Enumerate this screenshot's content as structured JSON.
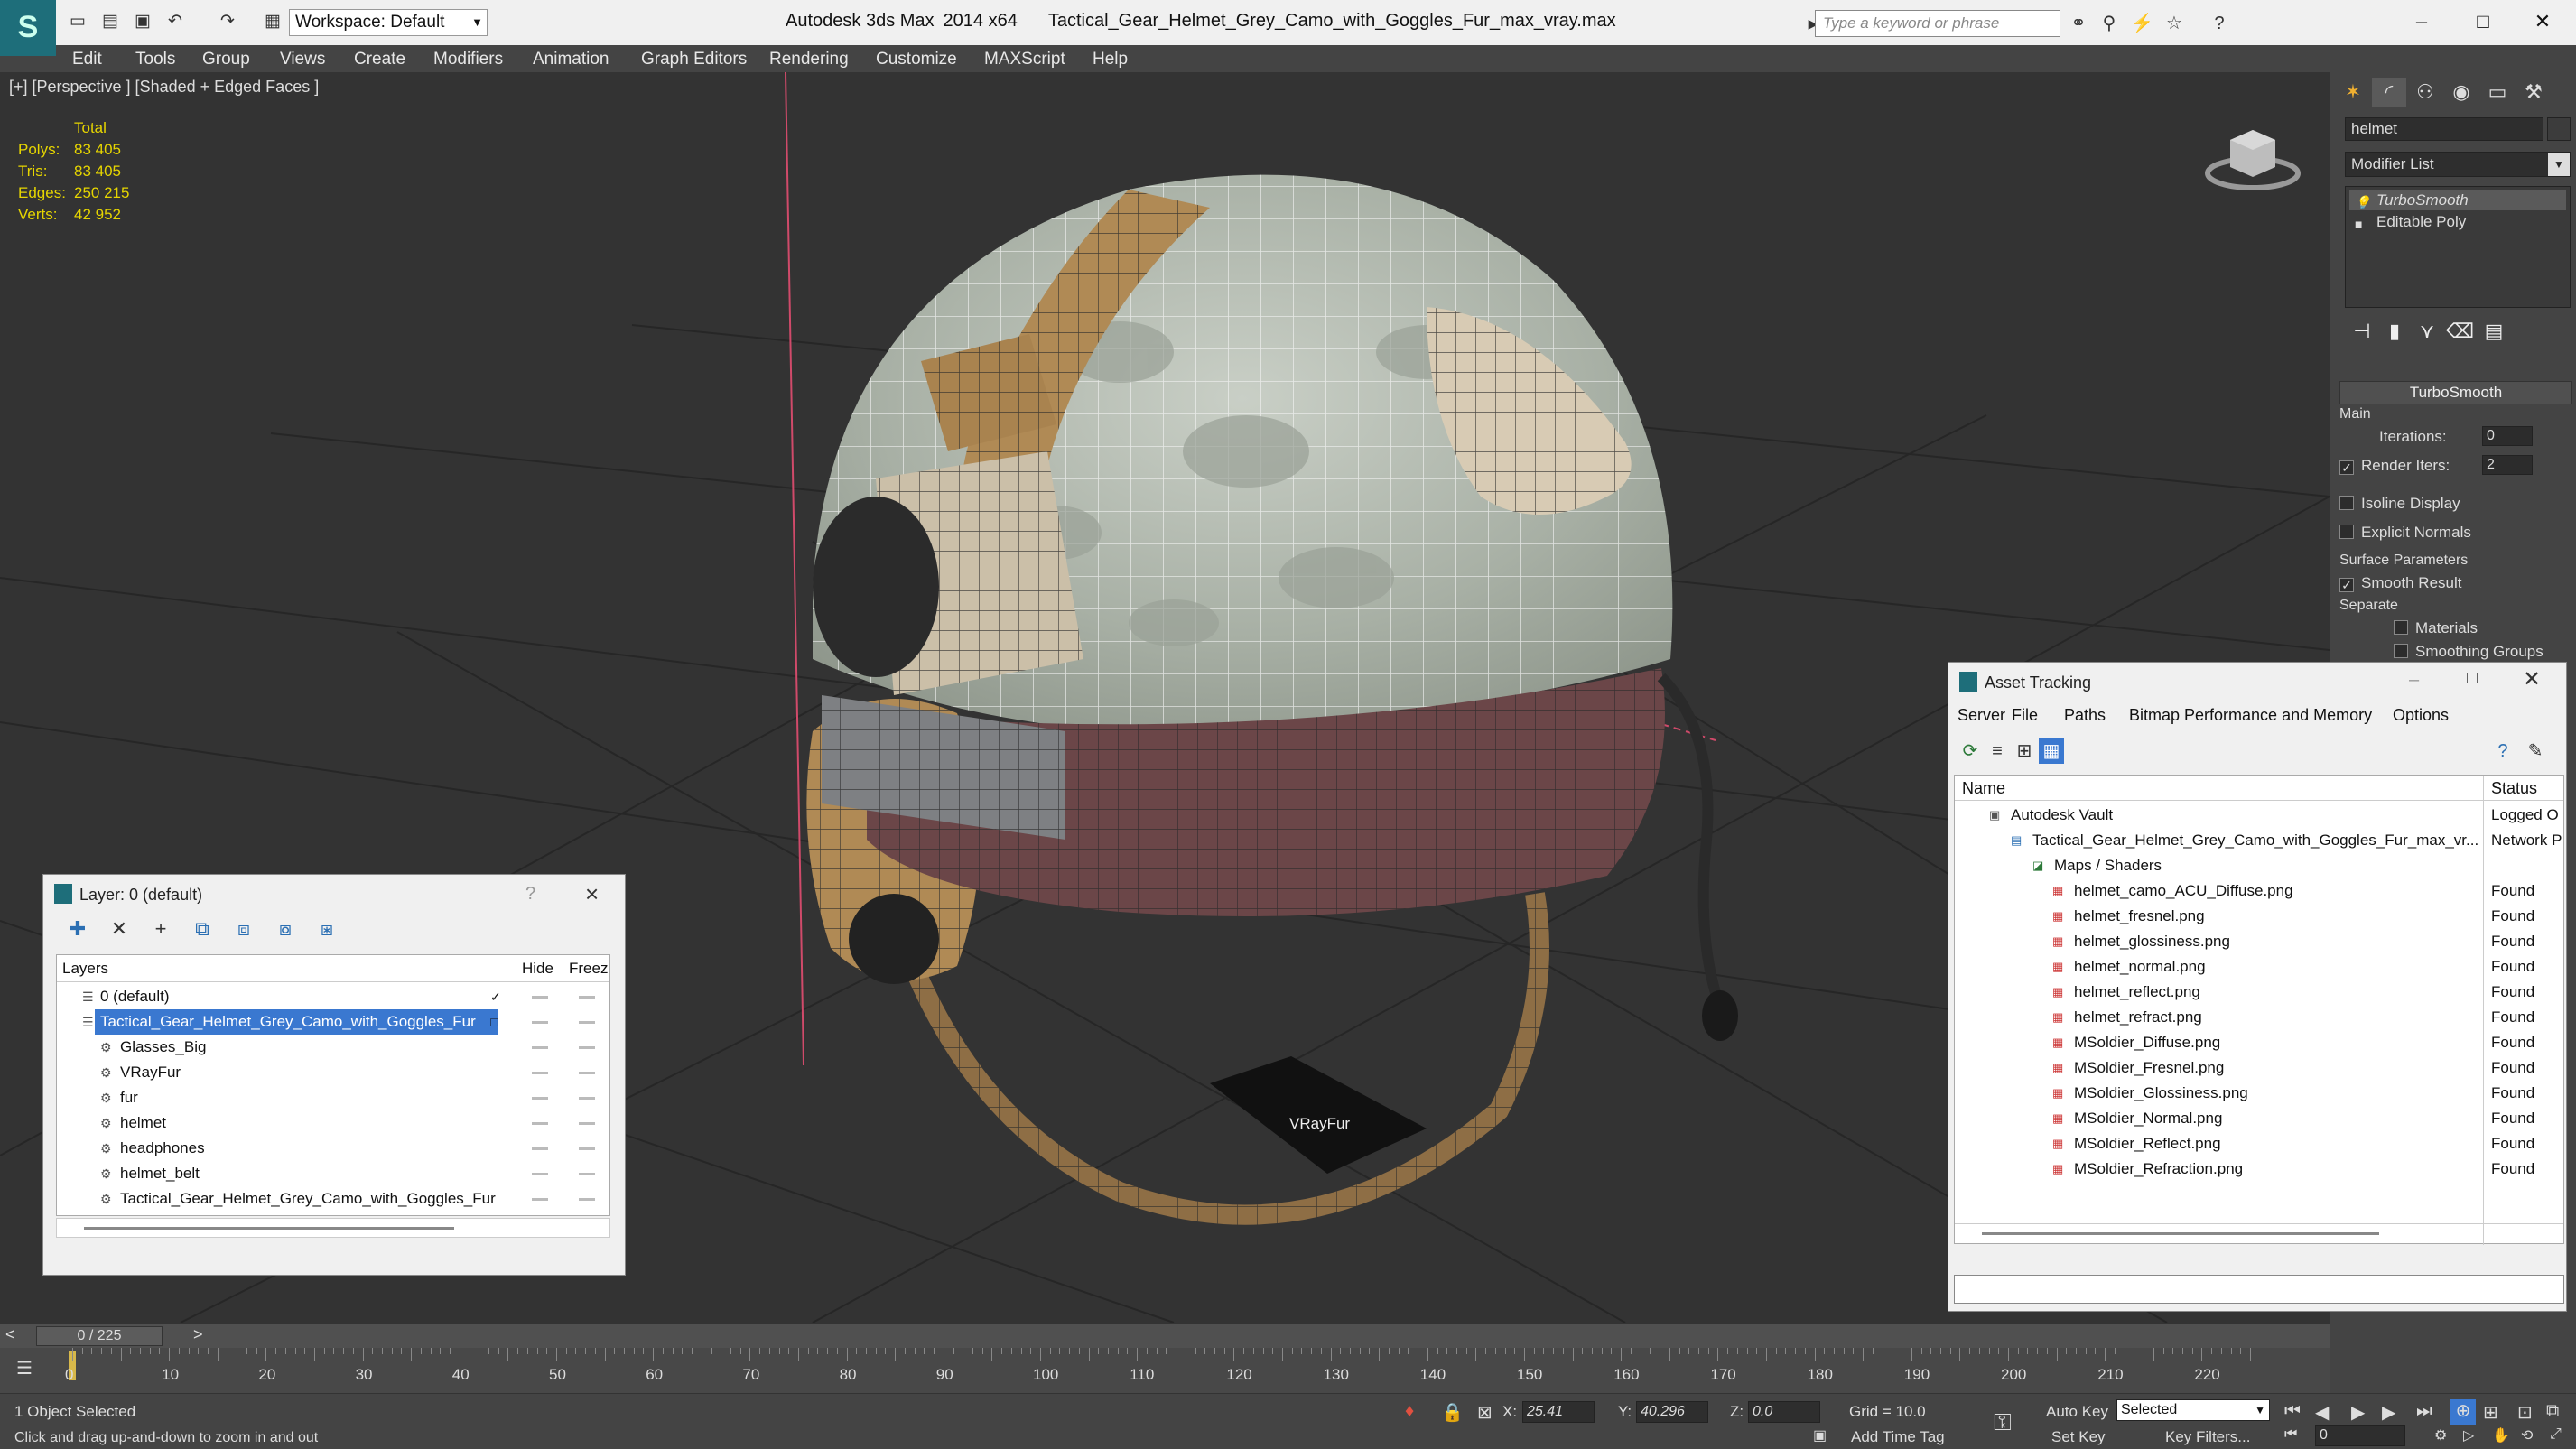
{
  "titlebar": {
    "app": "Autodesk 3ds Max",
    "version": "2014 x64",
    "file": "Tactical_Gear_Helmet_Grey_Camo_with_Goggles_Fur_max_vray.max",
    "workspace": "Workspace: Default",
    "search_placeholder": "Type a keyword or phrase"
  },
  "menu": [
    "Edit",
    "Tools",
    "Group",
    "Views",
    "Create",
    "Modifiers",
    "Animation",
    "Graph Editors",
    "Rendering",
    "Customize",
    "MAXScript",
    "Help"
  ],
  "viewport": {
    "label": "[+] [Perspective ] [Shaded + Edged Faces ]",
    "object_label": "VRayFur"
  },
  "stats": {
    "header": "Total",
    "rows": [
      {
        "label": "Polys:",
        "value": "83 405"
      },
      {
        "label": "Tris:",
        "value": "83 405"
      },
      {
        "label": "Edges:",
        "value": "250 215"
      },
      {
        "label": "Verts:",
        "value": "42 952"
      }
    ]
  },
  "command_panel": {
    "object_name": "helmet",
    "modifier_list": "Modifier List",
    "stack": [
      "TurboSmooth",
      "Editable Poly"
    ],
    "rollout": "TurboSmooth",
    "main": "Main",
    "iterations_label": "Iterations:",
    "iterations": "0",
    "render_iters_label": "Render Iters:",
    "render_iters": "2",
    "isoline": "Isoline Display",
    "explicit": "Explicit Normals",
    "surface": "Surface Parameters",
    "smooth_result": "Smooth Result",
    "separate": "Separate",
    "materials": "Materials",
    "smoothing_groups": "Smoothing Groups"
  },
  "layer_dialog": {
    "title": "Layer: 0 (default)",
    "help": "?",
    "col_layers": "Layers",
    "col_hide": "Hide",
    "col_freeze": "Freeze",
    "rows": [
      "0 (default)",
      "Tactical_Gear_Helmet_Grey_Camo_with_Goggles_Fur",
      "Glasses_Big",
      "VRayFur",
      "fur",
      "helmet",
      "headphones",
      "helmet_belt",
      "Tactical_Gear_Helmet_Grey_Camo_with_Goggles_Fur"
    ]
  },
  "asset_dialog": {
    "title": "Asset Tracking",
    "menu": [
      "Server",
      "File",
      "Paths",
      "Bitmap Performance and Memory",
      "Options"
    ],
    "col_name": "Name",
    "col_status": "Status",
    "rows": [
      {
        "name": "Autodesk Vault",
        "status": "Logged O"
      },
      {
        "name": "Tactical_Gear_Helmet_Grey_Camo_with_Goggles_Fur_max_vr...",
        "status": "Network P"
      },
      {
        "name": "Maps / Shaders",
        "status": ""
      },
      {
        "name": "helmet_camo_ACU_Diffuse.png",
        "status": "Found"
      },
      {
        "name": "helmet_fresnel.png",
        "status": "Found"
      },
      {
        "name": "helmet_glossiness.png",
        "status": "Found"
      },
      {
        "name": "helmet_normal.png",
        "status": "Found"
      },
      {
        "name": "helmet_reflect.png",
        "status": "Found"
      },
      {
        "name": "helmet_refract.png",
        "status": "Found"
      },
      {
        "name": "MSoldier_Diffuse.png",
        "status": "Found"
      },
      {
        "name": "MSoldier_Fresnel.png",
        "status": "Found"
      },
      {
        "name": "MSoldier_Glossiness.png",
        "status": "Found"
      },
      {
        "name": "MSoldier_Normal.png",
        "status": "Found"
      },
      {
        "name": "MSoldier_Reflect.png",
        "status": "Found"
      },
      {
        "name": "MSoldier_Refraction.png",
        "status": "Found"
      }
    ]
  },
  "timeline": {
    "position": "0 / 225",
    "ticks": [
      "0",
      "10",
      "20",
      "30",
      "40",
      "50",
      "60",
      "70",
      "80",
      "90",
      "100",
      "110",
      "120",
      "130",
      "140",
      "150",
      "160",
      "170",
      "180",
      "190",
      "200",
      "210",
      "220"
    ]
  },
  "status": {
    "selected": "1 Object Selected",
    "prompt": "Click and drag up-and-down to zoom in and out",
    "x_label": "X:",
    "x": "25.41",
    "y_label": "Y:",
    "y": "40.296",
    "z_label": "Z:",
    "z": "0.0",
    "grid": "Grid = 10.0",
    "add_time_tag": "Add Time Tag",
    "auto_key": "Auto Key",
    "set_key": "Set Key",
    "key_mode": "Selected",
    "key_filters": "Key Filters...",
    "frame": "0"
  },
  "colors": {
    "viewport_bg": "#333333",
    "accent_blue": "#3a78d0",
    "stats_yellow": "#e6d500"
  }
}
